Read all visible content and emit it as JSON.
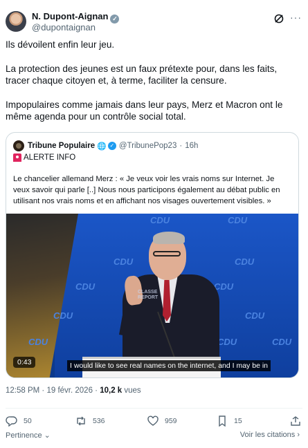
{
  "author": {
    "name": "N. Dupont-Aignan",
    "handle": "@dupontaignan"
  },
  "tweet": {
    "paragraphs": [
      "Ils dévoilent enfin leur jeu.",
      "La protection des jeunes est un faux prétexte pour, dans les faits, tracer chaque citoyen et, à terme, faciliter la censure.",
      "Impopulaires comme jamais dans leur pays, Merz et Macron ont le même agenda pour un contrôle social total."
    ]
  },
  "quote": {
    "name": "Tribune Populaire",
    "handle": "@TribunePop23",
    "separator": "·",
    "age": "16h",
    "alert": "ALERTE INFO",
    "text": "Le chancelier allemand Merz : « Je veux voir les vrais noms sur Internet. Je veux savoir qui parle [..] Nous nous participons également au débat public en utilisant nos vrais noms et en affichant nos visages ouvertement visibles. »",
    "video": {
      "duration": "0:43",
      "subtitle": "I would like to see real names on the internet, and I may be in",
      "backdrop_text": "CDU",
      "watermark": "CLASSE\nREPORT"
    }
  },
  "meta": {
    "time": "12:58 PM",
    "sep": " · ",
    "date": "19 févr. 2026",
    "views_count": "10,2 k",
    "views_label": " vues"
  },
  "actions": {
    "replies": "50",
    "reposts": "536",
    "likes": "959",
    "bookmarks": "15"
  },
  "footer": {
    "sort_label": "Pertinence",
    "quotes_label": "Voir les citations"
  },
  "colors": {
    "accent": "#1d9bf0",
    "muted": "#536471",
    "cdu_blue": "#1b56c7"
  }
}
